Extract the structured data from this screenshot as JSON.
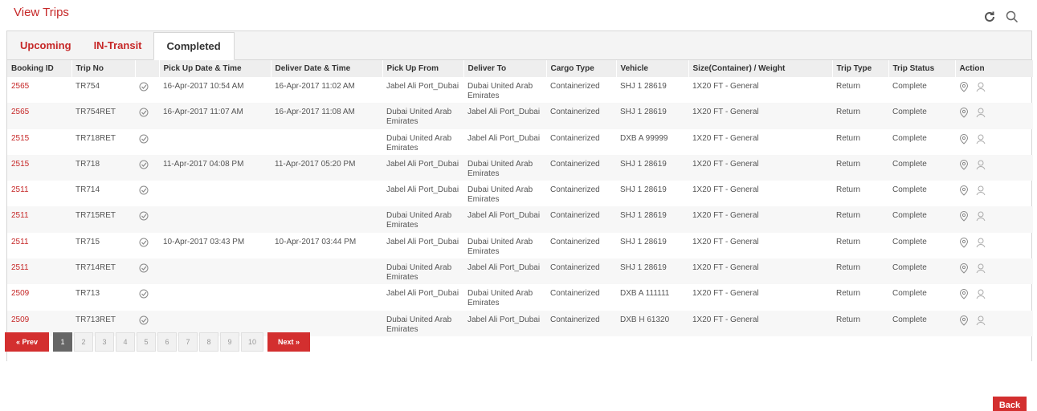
{
  "page": {
    "title": "View Trips"
  },
  "tabs": [
    {
      "label": "Upcoming"
    },
    {
      "label": "IN-Transit"
    },
    {
      "label": "Completed"
    }
  ],
  "table": {
    "headers": [
      "Booking ID",
      "Trip No",
      "",
      "Pick Up Date & Time",
      "Deliver Date & Time",
      "Pick Up From",
      "Deliver To",
      "Cargo Type",
      "Vehicle",
      "Size(Container) / Weight",
      "Trip Type",
      "Trip Status",
      "Action"
    ],
    "rows": [
      {
        "booking_id": "2565",
        "trip_no": "TR754",
        "pickup_dt": "16-Apr-2017 10:54 AM",
        "deliver_dt": "16-Apr-2017 11:02 AM",
        "pickup_from": "Jabel Ali Port_Dubai",
        "deliver_to": "Dubai United Arab Emirates",
        "cargo": "Containerized",
        "vehicle": "SHJ 1 28619",
        "size": "1X20 FT - General",
        "trip_type": "Return",
        "status": "Complete"
      },
      {
        "booking_id": "2565",
        "trip_no": "TR754RET",
        "pickup_dt": "16-Apr-2017 11:07 AM",
        "deliver_dt": "16-Apr-2017 11:08 AM",
        "pickup_from": "Dubai United Arab Emirates",
        "deliver_to": "Jabel Ali Port_Dubai",
        "cargo": "Containerized",
        "vehicle": "SHJ 1 28619",
        "size": "1X20 FT - General",
        "trip_type": "Return",
        "status": "Complete"
      },
      {
        "booking_id": "2515",
        "trip_no": "TR718RET",
        "pickup_dt": "",
        "deliver_dt": "",
        "pickup_from": "Dubai United Arab Emirates",
        "deliver_to": "Jabel Ali Port_Dubai",
        "cargo": "Containerized",
        "vehicle": "DXB A 99999",
        "size": "1X20 FT - General",
        "trip_type": "Return",
        "status": "Complete"
      },
      {
        "booking_id": "2515",
        "trip_no": "TR718",
        "pickup_dt": "11-Apr-2017 04:08 PM",
        "deliver_dt": "11-Apr-2017 05:20 PM",
        "pickup_from": "Jabel Ali Port_Dubai",
        "deliver_to": "Dubai United Arab Emirates",
        "cargo": "Containerized",
        "vehicle": "SHJ 1 28619",
        "size": "1X20 FT - General",
        "trip_type": "Return",
        "status": "Complete"
      },
      {
        "booking_id": "2511",
        "trip_no": "TR714",
        "pickup_dt": "",
        "deliver_dt": "",
        "pickup_from": "Jabel Ali Port_Dubai",
        "deliver_to": "Dubai United Arab Emirates",
        "cargo": "Containerized",
        "vehicle": "SHJ 1 28619",
        "size": "1X20 FT - General",
        "trip_type": "Return",
        "status": "Complete"
      },
      {
        "booking_id": "2511",
        "trip_no": "TR715RET",
        "pickup_dt": "",
        "deliver_dt": "",
        "pickup_from": "Dubai United Arab Emirates",
        "deliver_to": "Jabel Ali Port_Dubai",
        "cargo": "Containerized",
        "vehicle": "SHJ 1 28619",
        "size": "1X20 FT - General",
        "trip_type": "Return",
        "status": "Complete"
      },
      {
        "booking_id": "2511",
        "trip_no": "TR715",
        "pickup_dt": "10-Apr-2017 03:43 PM",
        "deliver_dt": "10-Apr-2017 03:44 PM",
        "pickup_from": "Jabel Ali Port_Dubai",
        "deliver_to": "Dubai United Arab Emirates",
        "cargo": "Containerized",
        "vehicle": "SHJ 1 28619",
        "size": "1X20 FT - General",
        "trip_type": "Return",
        "status": "Complete"
      },
      {
        "booking_id": "2511",
        "trip_no": "TR714RET",
        "pickup_dt": "",
        "deliver_dt": "",
        "pickup_from": "Dubai United Arab Emirates",
        "deliver_to": "Jabel Ali Port_Dubai",
        "cargo": "Containerized",
        "vehicle": "SHJ 1 28619",
        "size": "1X20 FT - General",
        "trip_type": "Return",
        "status": "Complete"
      },
      {
        "booking_id": "2509",
        "trip_no": "TR713",
        "pickup_dt": "",
        "deliver_dt": "",
        "pickup_from": "Jabel Ali Port_Dubai",
        "deliver_to": "Dubai United Arab Emirates",
        "cargo": "Containerized",
        "vehicle": "DXB A 111111",
        "size": "1X20 FT - General",
        "trip_type": "Return",
        "status": "Complete"
      },
      {
        "booking_id": "2509",
        "trip_no": "TR713RET",
        "pickup_dt": "",
        "deliver_dt": "",
        "pickup_from": "Dubai United Arab Emirates",
        "deliver_to": "Jabel Ali Port_Dubai",
        "cargo": "Containerized",
        "vehicle": "DXB H 61320",
        "size": "1X20 FT - General",
        "trip_type": "Return",
        "status": "Complete"
      }
    ]
  },
  "pagination": {
    "prev_label": "« Prev",
    "next_label": "Next »",
    "pages": [
      "1",
      "2",
      "3",
      "4",
      "5",
      "6",
      "7",
      "8",
      "9",
      "10"
    ],
    "current": "1"
  },
  "footer": {
    "back_label": "Back"
  },
  "icons": {
    "refresh": "refresh-icon",
    "search": "search-icon",
    "verified": "check-circle-icon",
    "location": "map-pin-icon",
    "driver": "user-location-icon"
  },
  "colors": {
    "accent": "#c62828",
    "button": "#d32f2f",
    "current_page": "#666666"
  }
}
